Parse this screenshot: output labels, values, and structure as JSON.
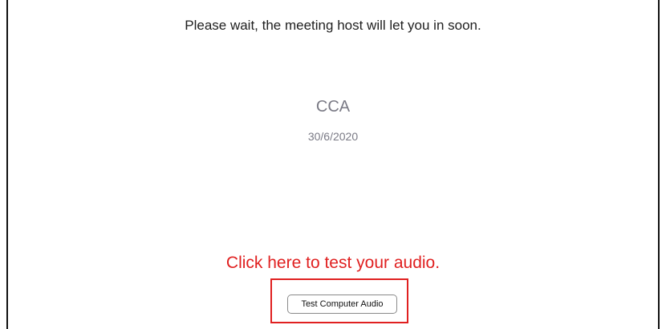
{
  "waiting_room": {
    "message": "Please wait, the meeting host will let you in soon.",
    "meeting_title": "CCA",
    "meeting_date": "30/6/2020"
  },
  "annotation": {
    "text": "Click here to test your audio.",
    "color": "#e02020"
  },
  "audio": {
    "test_button_label": "Test Computer Audio"
  }
}
